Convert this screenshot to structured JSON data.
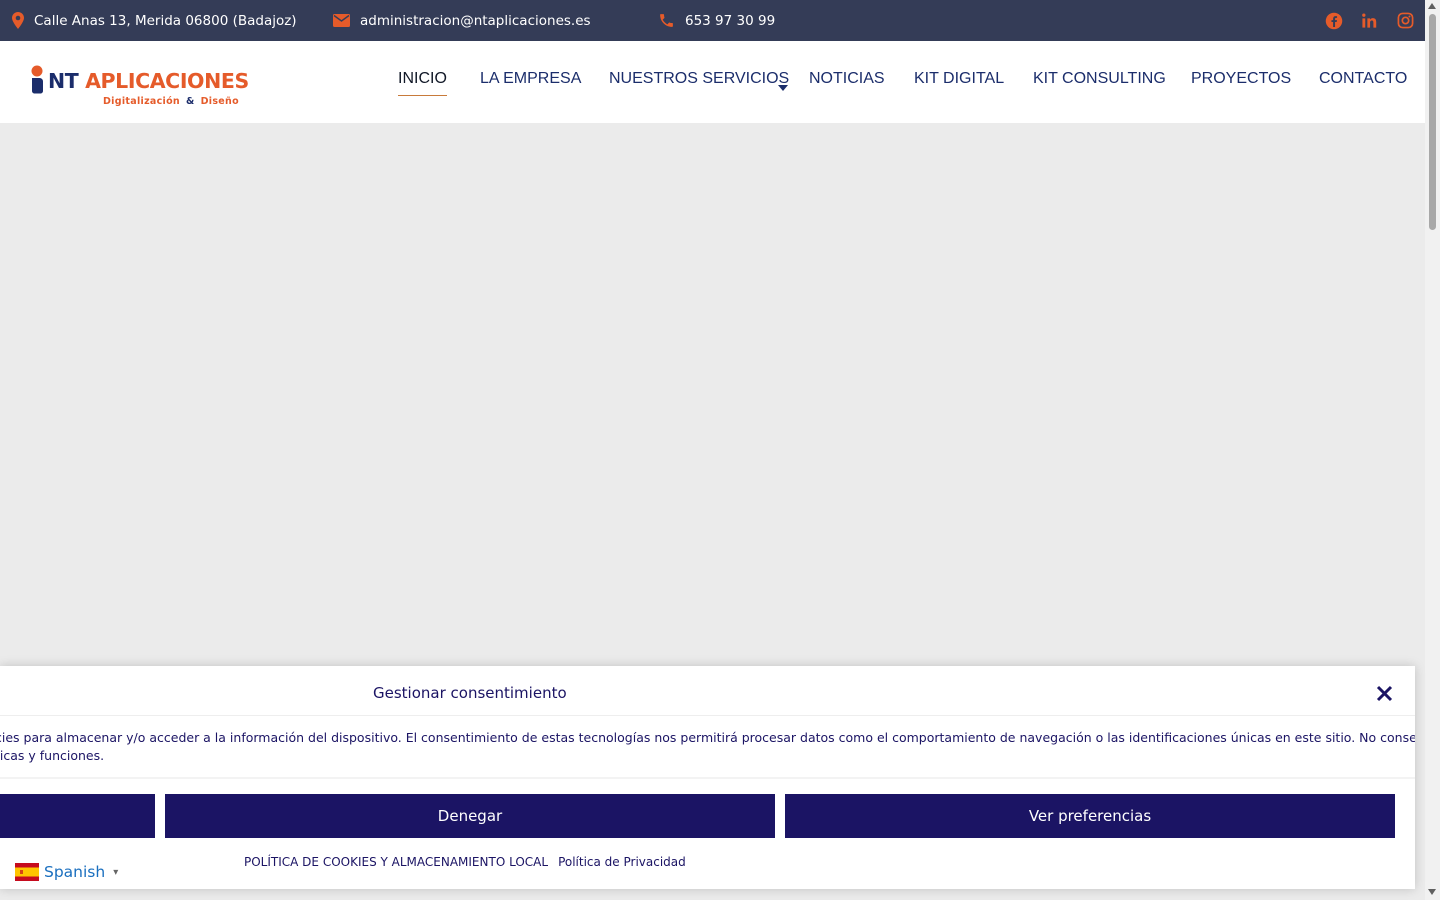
{
  "topbar": {
    "address": "Calle Anas 13, Merida 06800 (Badajoz)",
    "email": "administracion@ntaplicaciones.es",
    "phone": "653 97 30 99",
    "icons": [
      "map-pin-icon",
      "envelope-icon",
      "phone-icon",
      "facebook-icon",
      "linkedin-icon",
      "instagram-icon"
    ],
    "icon_color": "#e55b2a",
    "bg_color": "#343c57"
  },
  "logo": {
    "prefix": "NT",
    "name": "APLICACIONES",
    "tagline_left": "Digitalización",
    "tagline_amp": "&",
    "tagline_right": "Diseño"
  },
  "nav": {
    "items": [
      {
        "label": "INICIO",
        "active": true
      },
      {
        "label": "LA EMPRESA"
      },
      {
        "label": "NUESTROS SERVICIOS",
        "has_dropdown": true
      },
      {
        "label": "NOTICIAS"
      },
      {
        "label": "KIT DIGITAL"
      },
      {
        "label": "KIT CONSULTING"
      },
      {
        "label": "PROYECTOS"
      },
      {
        "label": "CONTACTO"
      }
    ],
    "color": "#1b2d6b",
    "accent": "#c87a3a"
  },
  "consent": {
    "title": "Gestionar consentimiento",
    "message_line1": "cies para almacenar y/o acceder a la información del dispositivo. El consentimiento de estas tecnologías nos permitirá procesar datos como el comportamiento de navegación o las identificaciones únicas en este sitio. No consentir o",
    "message_line2": "ticas y funciones.",
    "deny_label": "Denegar",
    "prefs_label": "Ver preferencias",
    "cookie_policy_link": "POLÍTICA DE COOKIES Y ALMACENAMIENTO LOCAL",
    "privacy_link": "Política de Privacidad",
    "button_color": "#1b1464"
  },
  "language": {
    "label": "Spanish",
    "caret": "▾",
    "flag": "spain-flag-icon"
  }
}
